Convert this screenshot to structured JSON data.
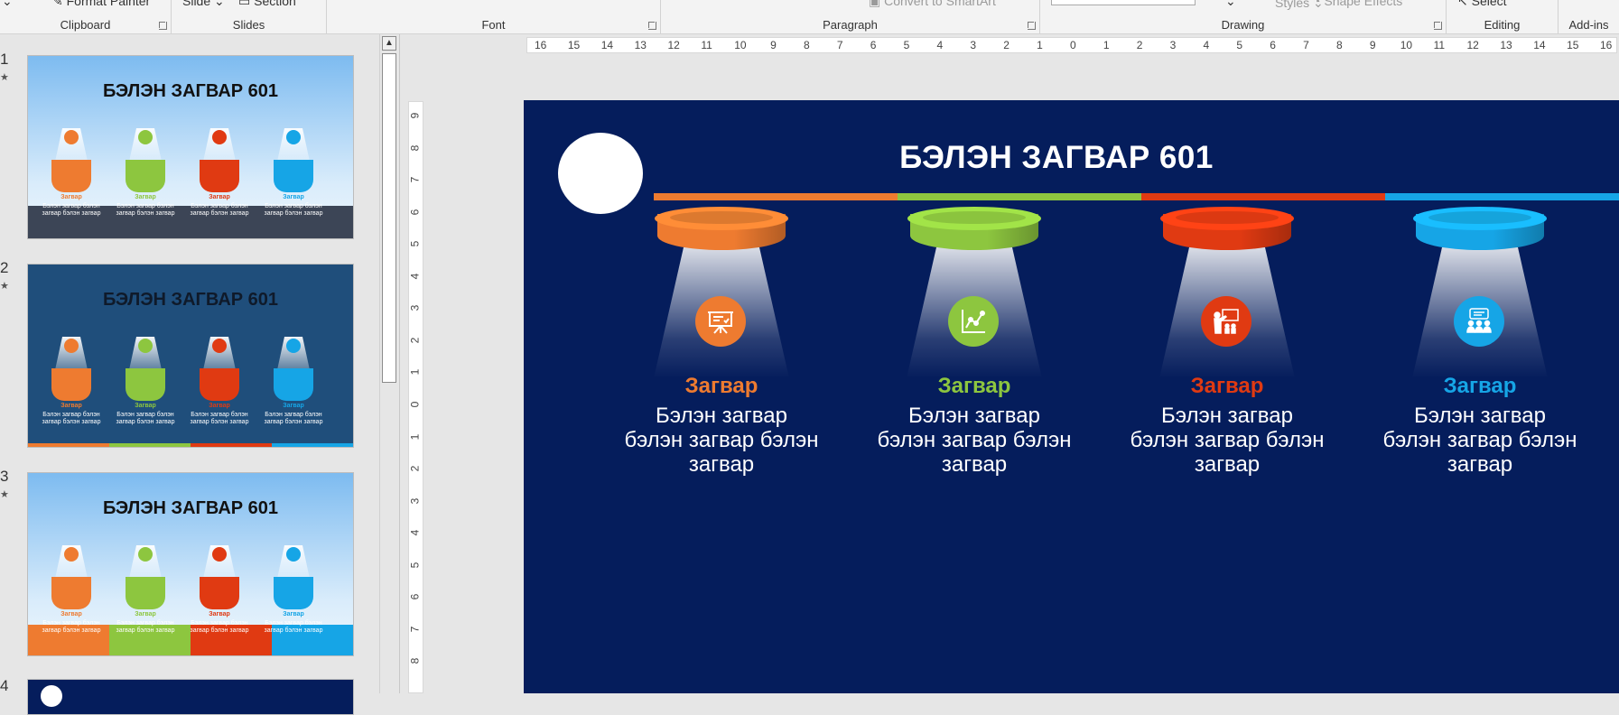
{
  "ribbon": {
    "groups": [
      {
        "label": "Clipboard"
      },
      {
        "label": "Slides"
      },
      {
        "label": "Font"
      },
      {
        "label": "Paragraph"
      },
      {
        "label": "Drawing"
      },
      {
        "label": "Editing"
      },
      {
        "label": "Add-ins"
      }
    ],
    "partial": {
      "format_painter": "Format Painter",
      "slide": "Slide",
      "section": "Section",
      "convert_smartart": "Convert to SmartArt",
      "styles": "Styles",
      "shape_effects": "Shape Effects",
      "select": "Select"
    }
  },
  "thumbnails": [
    {
      "number": "1",
      "title": "БЭЛЭН ЗАГВАР 601",
      "style": "sky-dark-footer"
    },
    {
      "number": "2",
      "title": "БЭЛЭН ЗАГВАР 601",
      "style": "blue"
    },
    {
      "number": "3",
      "title": "БЭЛЭН ЗАГВАР 601",
      "style": "sky-color-footer"
    },
    {
      "number": "4"
    }
  ],
  "thumb_column": {
    "label": "Загвар",
    "text": "Бэлэн загвар бэлэн загвар бэлэн загвар"
  },
  "ruler": {
    "horizontal": [
      "16",
      "15",
      "14",
      "13",
      "12",
      "11",
      "10",
      "9",
      "8",
      "7",
      "6",
      "5",
      "4",
      "3",
      "2",
      "1",
      "0",
      "1",
      "2",
      "3",
      "4",
      "5",
      "6",
      "7",
      "8",
      "9",
      "10",
      "11",
      "12",
      "13",
      "14",
      "15",
      "16"
    ],
    "vertical": [
      "9",
      "8",
      "7",
      "6",
      "5",
      "4",
      "3",
      "2",
      "1",
      "0",
      "1",
      "2",
      "3",
      "4",
      "5",
      "6",
      "7",
      "8"
    ]
  },
  "slide": {
    "title": "БЭЛЭН ЗАГВАР 601",
    "columns": [
      {
        "label": "Загвар",
        "text": "Бэлэн загвар\nбэлэн загвар бэлэн\nзагвар",
        "color": "#ee7b30",
        "icon": "presentation-board-icon"
      },
      {
        "label": "Загвар",
        "text": "Бэлэн загвар\nбэлэн загвар бэлэн\nзагвар",
        "color": "#8dc63f",
        "icon": "line-chart-icon"
      },
      {
        "label": "Загвар",
        "text": "Бэлэн загвар\nбэлэн загвар бэлэн\nзагвар",
        "color": "#e03a12",
        "icon": "teacher-icon"
      },
      {
        "label": "Загвар",
        "text": "Бэлэн загвар\nбэлэн загвар бэлэн\nзагвар",
        "color": "#16a5e6",
        "icon": "meeting-icon"
      }
    ]
  },
  "colors": {
    "slide_bg": "#051d5c",
    "orange": "#ee7b30",
    "green": "#8dc63f",
    "red": "#e03a12",
    "blue": "#16a5e6"
  }
}
